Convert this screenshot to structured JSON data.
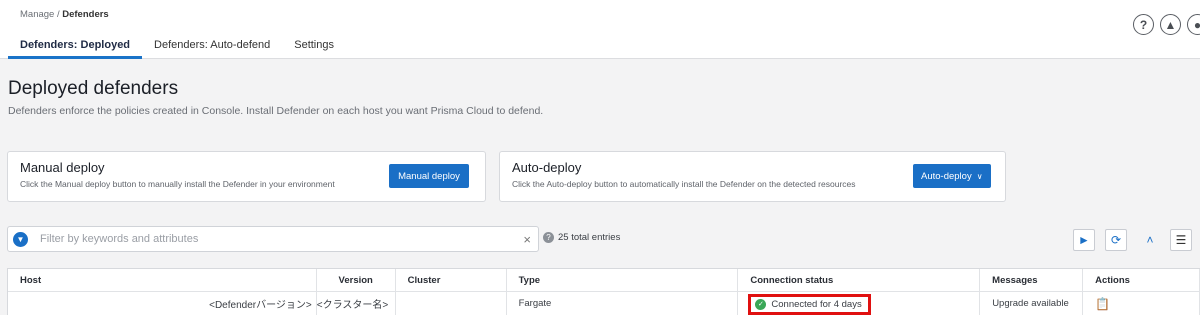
{
  "breadcrumb": {
    "parent": "Manage / ",
    "current": "Defenders"
  },
  "tabs": [
    {
      "label": "Defenders: Deployed",
      "active": true
    },
    {
      "label": "Defenders: Auto-defend",
      "active": false
    },
    {
      "label": "Settings",
      "active": false
    }
  ],
  "top_icons": [
    "help-icon",
    "notification-icon",
    "user-icon"
  ],
  "page": {
    "title": "Deployed defenders",
    "subtitle": "Defenders enforce the policies created in Console. Install Defender on each host you want Prisma Cloud to defend."
  },
  "manual_card": {
    "title": "Manual deploy",
    "desc": "Click the Manual deploy button to manually install the Defender in your environment",
    "button": "Manual deploy"
  },
  "auto_card": {
    "title": "Auto-deploy",
    "desc": "Click the Auto-deploy button to automatically install the Defender on the detected resources",
    "button": "Auto-deploy"
  },
  "filter": {
    "placeholder": "Filter by keywords and attributes",
    "clear": "×"
  },
  "entries": "25 total entries",
  "table": {
    "headers": [
      "Host",
      "Version",
      "Cluster",
      "Type",
      "Connection status",
      "Messages",
      "Actions"
    ],
    "rows": [
      {
        "host": "",
        "version": "<Defenderバージョン>",
        "cluster": "<クラスター名>",
        "type": "Fargate",
        "status": "Connected for 4 days",
        "messages": "Upgrade available"
      }
    ]
  },
  "colors": {
    "accent": "#1a6fc6",
    "highlight": "#e01010",
    "ok": "#3aa757"
  }
}
